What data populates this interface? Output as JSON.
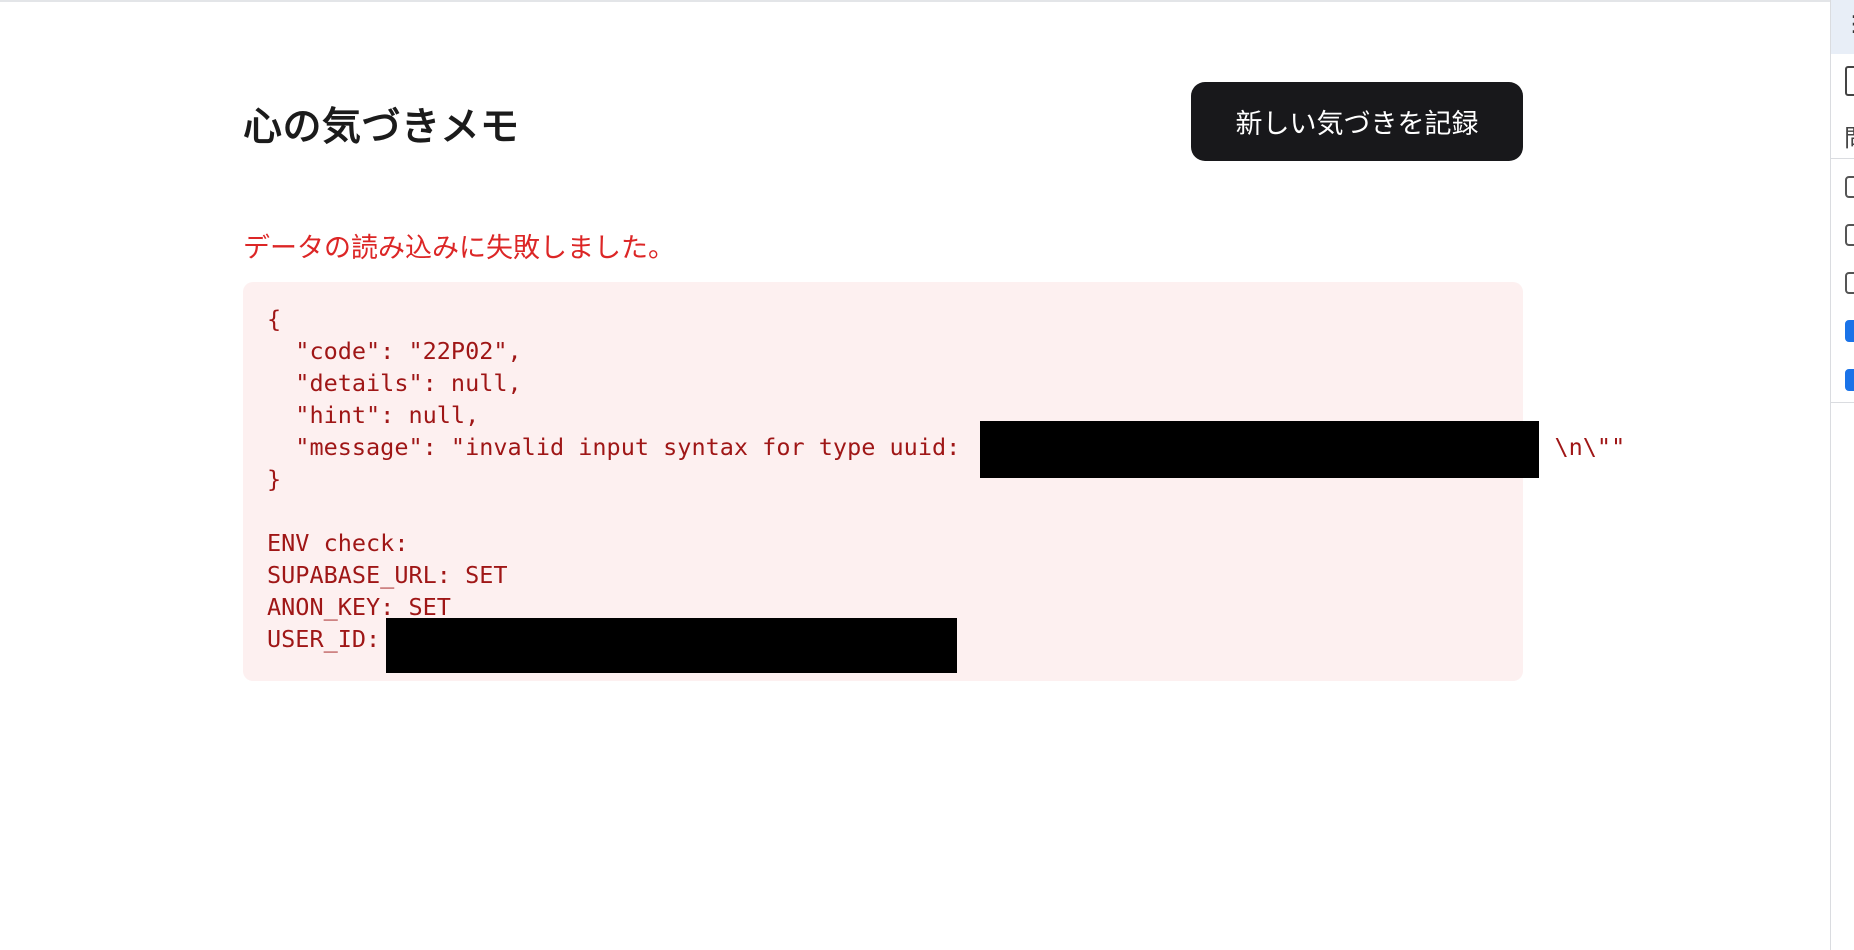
{
  "header": {
    "title": "心の気づきメモ",
    "new_button_label": "新しい気づきを記録"
  },
  "error": {
    "message": "データの読み込みに失敗しました。",
    "details": "{\n  \"code\": \"22P02\",\n  \"details\": null,\n  \"hint\": null,\n  \"message\": \"invalid input syntax for type uuid:                                          \\n\\\"\"\n}\n\nENV check:\nSUPABASE_URL: SET\nANON_KEY: SET\nUSER_ID:"
  },
  "side_panel": {
    "menu_icon": "vertical-dots-icon",
    "label": "問",
    "checkboxes": [
      false,
      false,
      false,
      true,
      true
    ]
  },
  "colors": {
    "error_text": "#dc2626",
    "error_bg": "#fdf0f0",
    "button_bg": "#18181b"
  }
}
